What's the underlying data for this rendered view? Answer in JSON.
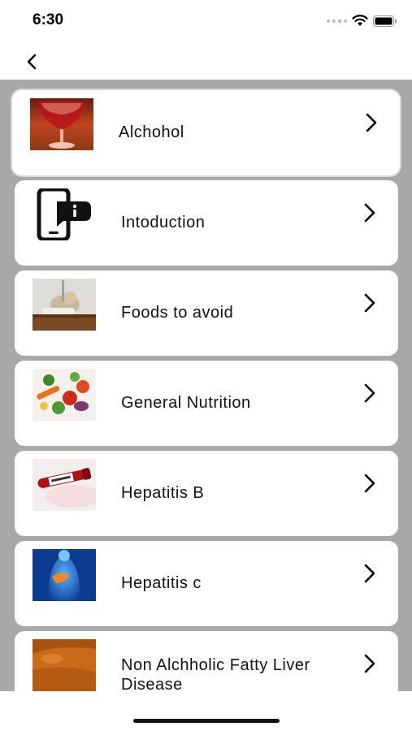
{
  "status_bar": {
    "time": "6:30",
    "icons": [
      "signal-dots-icon",
      "wifi-icon",
      "battery-icon"
    ]
  },
  "nav": {
    "back_icon": "chevron-left-icon"
  },
  "list": {
    "items": [
      {
        "label": "Alchohol",
        "icon": "wine-glass-photo",
        "selected": true
      },
      {
        "label": "Intoduction",
        "icon": "phone-info-icon"
      },
      {
        "label": "Foods to avoid",
        "icon": "sleeping-man-photo"
      },
      {
        "label": "General Nutrition",
        "icon": "vegetables-photo"
      },
      {
        "label": "Hepatitis B",
        "icon": "blood-tube-photo"
      },
      {
        "label": "Hepatitis c",
        "icon": "liver-anatomy-photo"
      },
      {
        "label": "Non Alchholic Fatty Liver Disease",
        "icon": "fatty-liver-photo"
      }
    ]
  },
  "colors": {
    "background": "#ffffff",
    "list_background": "#a8a8a8",
    "row_background": "#ffffff",
    "text": "#111111"
  }
}
